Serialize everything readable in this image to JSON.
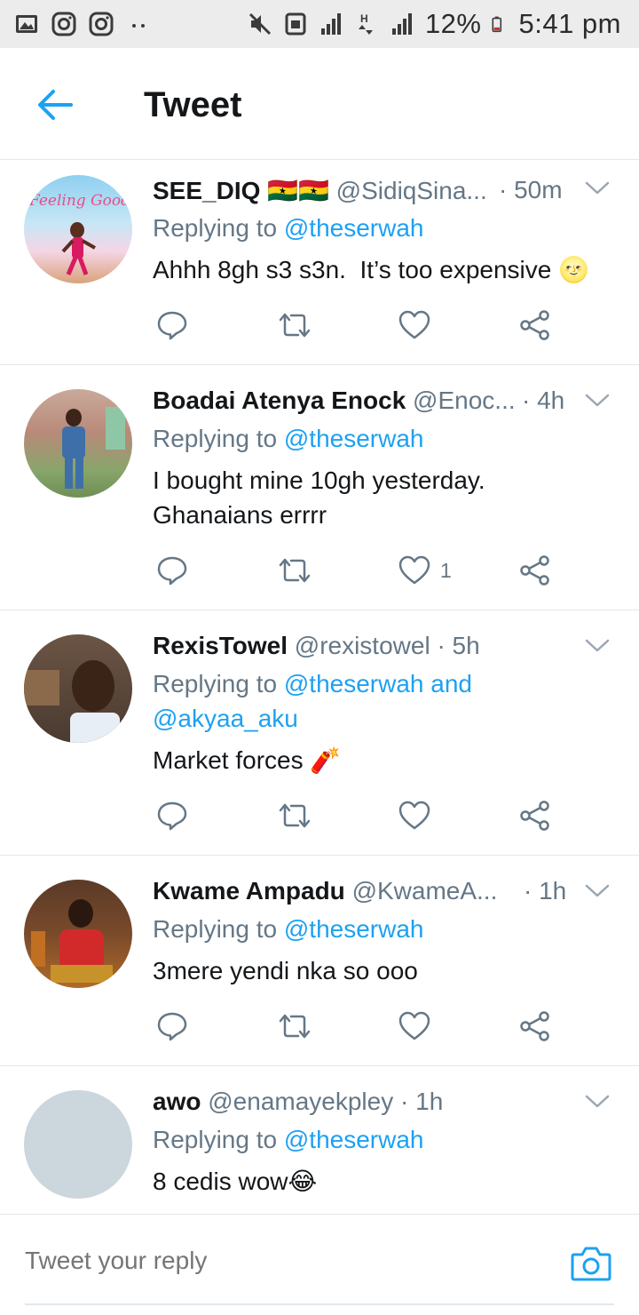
{
  "status_bar": {
    "battery": "12%",
    "time": "5:41 pm",
    "left_icons": [
      "image-icon",
      "instagram-icon",
      "instagram-icon",
      "more-dots-icon"
    ],
    "right_icons": [
      "mute-icon",
      "data-saver-icon",
      "signal-icon",
      "data-transfer-icon",
      "signal-icon",
      "battery-icon"
    ]
  },
  "header": {
    "title": "Tweet",
    "back_icon": "arrow-left-icon"
  },
  "colors": {
    "accent": "#1da1f2",
    "text": "#14171a",
    "secondary": "#657786",
    "divider": "#e1e8ed",
    "status_bar_bg": "#ececec"
  },
  "tweets": [
    {
      "name": "SEE_DIQ 🇬🇭🇬🇭",
      "handle": "@SidiqSina...",
      "time": "· 50m",
      "reply_prefix": "Replying to ",
      "reply_mention": "@theserwah",
      "text": "Ahhh 8gh s3 s3n.  It’s too expensive 🌝",
      "like_count": "",
      "avatar_label": "Feeling Good"
    },
    {
      "name": "Boadai Atenya Enock",
      "handle": "@Enoc...",
      "time": "· 4h",
      "reply_prefix": "Replying to ",
      "reply_mention": "@theserwah",
      "text": "I bought mine 10gh yesterday.\nGhanaians errrr",
      "like_count": "1",
      "avatar_label": ""
    },
    {
      "name": "RexisTowel",
      "handle": "@rexistowel",
      "time": "· 5h",
      "reply_prefix": "Replying to ",
      "reply_mention": "@theserwah and\n@akyaa_aku",
      "text": "Market forces 🧨",
      "like_count": "",
      "avatar_label": ""
    },
    {
      "name": "Kwame Ampadu",
      "handle": "@KwameA...",
      "time": "· 1h",
      "reply_prefix": "Replying to ",
      "reply_mention": "@theserwah",
      "text": "3mere yendi nka so ooo",
      "like_count": "",
      "avatar_label": ""
    },
    {
      "name": "awo",
      "handle": "@enamayekpley",
      "time": "· 1h",
      "reply_prefix": "Replying to ",
      "reply_mention": "@theserwah",
      "text": "8 cedis wow😂",
      "like_count": "",
      "avatar_label": ""
    }
  ],
  "reply_bar": {
    "placeholder": "Tweet your reply",
    "camera_icon": "camera-icon"
  }
}
